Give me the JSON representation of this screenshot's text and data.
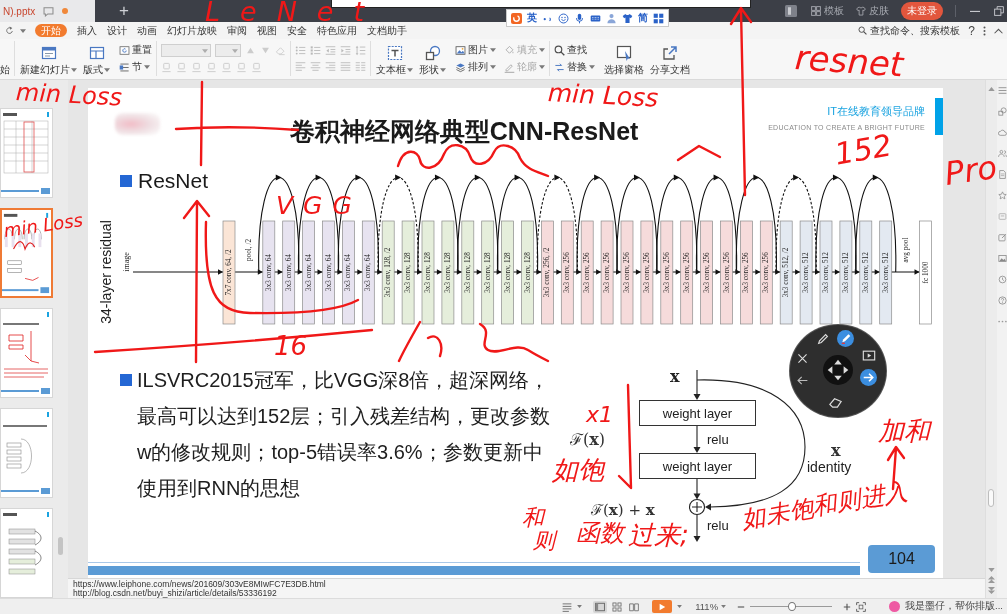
{
  "title_bar": {
    "document_tab": "N).pptx",
    "new_tab": "+",
    "template": "模板",
    "skin": "皮肤",
    "login": "未登录"
  },
  "menu": {
    "tabs": [
      {
        "label": "开始",
        "selected": true
      },
      {
        "label": "插入",
        "selected": false
      },
      {
        "label": "设计",
        "selected": false
      },
      {
        "label": "动画",
        "selected": false
      },
      {
        "label": "幻灯片放映",
        "selected": false
      },
      {
        "label": "审阅",
        "selected": false
      },
      {
        "label": "视图",
        "selected": false
      },
      {
        "label": "安全",
        "selected": false
      },
      {
        "label": "特色应用",
        "selected": false
      },
      {
        "label": "文档助手",
        "selected": false
      }
    ],
    "search": "查找命令、搜索模板",
    "help": "?"
  },
  "ime_toolbar": {
    "mode": "英",
    "script": "简"
  },
  "ribbon": [
    {
      "kind": "stack",
      "items": [
        {
          "label": "始",
          "disabled": false,
          "dropdown": false
        }
      ]
    },
    {
      "kind": "large",
      "items": [
        {
          "label": "新建幻灯片",
          "disabled": false,
          "dropdown": true
        },
        {
          "label": "版式",
          "disabled": false,
          "dropdown": true
        }
      ]
    },
    {
      "kind": "stack",
      "items": [
        {
          "label": "重置",
          "disabled": false,
          "dropdown": false
        },
        {
          "label": "节",
          "disabled": false,
          "dropdown": true
        }
      ]
    },
    {
      "kind": "font",
      "disabled": true
    },
    {
      "kind": "paragraph",
      "disabled": true
    },
    {
      "kind": "large",
      "items": [
        {
          "label": "文本框",
          "disabled": false,
          "dropdown": true
        },
        {
          "label": "形状",
          "disabled": false,
          "dropdown": true
        }
      ]
    },
    {
      "kind": "stack",
      "items": [
        {
          "label": "图片",
          "disabled": false,
          "dropdown": true
        },
        {
          "label": "排列",
          "disabled": false,
          "dropdown": true
        }
      ]
    },
    {
      "kind": "stack",
      "items": [
        {
          "label": "填充",
          "disabled": true,
          "dropdown": true
        },
        {
          "label": "轮廓",
          "disabled": true,
          "dropdown": true
        }
      ]
    },
    {
      "kind": "stack",
      "items": [
        {
          "label": "查找",
          "disabled": false,
          "dropdown": false
        },
        {
          "label": "替换",
          "disabled": false,
          "dropdown": true
        }
      ]
    },
    {
      "kind": "large",
      "items": [
        {
          "label": "选择窗格",
          "disabled": false,
          "dropdown": false
        },
        {
          "label": "分享文档",
          "disabled": false,
          "dropdown": false
        }
      ]
    }
  ],
  "thumbnails": [
    {
      "selected": false
    },
    {
      "selected": true
    },
    {
      "selected": false
    },
    {
      "selected": false
    },
    {
      "selected": false
    }
  ],
  "slide": {
    "title": "卷积神经网络典型CNN-ResNet",
    "brand": {
      "slogan": "IT在线教育领导品牌",
      "tagline": "EDUCATION TO CREATE A BRIGHT FUTURE"
    },
    "heading": "ResNet",
    "diagram": {
      "title": "34-layer residual",
      "input": "image",
      "layers": [
        {
          "label": "7x7 conv, 64, /2",
          "kind": "box",
          "color": "#fbe5d6"
        },
        {
          "label": "pool, /2",
          "kind": "text"
        },
        {
          "label": "3x3 conv, 64",
          "kind": "box",
          "color": "#e7e3f0"
        },
        {
          "label": "3x3 conv, 64",
          "kind": "box",
          "color": "#e7e3f0"
        },
        {
          "label": "3x3 conv, 64",
          "kind": "box",
          "color": "#e7e3f0"
        },
        {
          "label": "3x3 conv, 64",
          "kind": "box",
          "color": "#e7e3f0"
        },
        {
          "label": "3x3 conv, 64",
          "kind": "box",
          "color": "#e7e3f0"
        },
        {
          "label": "3x3 conv, 64",
          "kind": "box",
          "color": "#e7e3f0"
        },
        {
          "label": "3x3 conv, 128, /2",
          "kind": "box",
          "color": "#e5eedb"
        },
        {
          "label": "3x3 conv, 128",
          "kind": "box",
          "color": "#e5eedb"
        },
        {
          "label": "3x3 conv, 128",
          "kind": "box",
          "color": "#e5eedb"
        },
        {
          "label": "3x3 conv, 128",
          "kind": "box",
          "color": "#e5eedb"
        },
        {
          "label": "3x3 conv, 128",
          "kind": "box",
          "color": "#e5eedb"
        },
        {
          "label": "3x3 conv, 128",
          "kind": "box",
          "color": "#e5eedb"
        },
        {
          "label": "3x3 conv, 128",
          "kind": "box",
          "color": "#e5eedb"
        },
        {
          "label": "3x3 conv, 128",
          "kind": "box",
          "color": "#e5eedb"
        },
        {
          "label": "3x3 conv, 256, /2",
          "kind": "box",
          "color": "#f6dbdb"
        },
        {
          "label": "3x3 conv, 256",
          "kind": "box",
          "color": "#f6dbdb"
        },
        {
          "label": "3x3 conv, 256",
          "kind": "box",
          "color": "#f6dbdb"
        },
        {
          "label": "3x3 conv, 256",
          "kind": "box",
          "color": "#f6dbdb"
        },
        {
          "label": "3x3 conv, 256",
          "kind": "box",
          "color": "#f6dbdb"
        },
        {
          "label": "3x3 conv, 256",
          "kind": "box",
          "color": "#f6dbdb"
        },
        {
          "label": "3x3 conv, 256",
          "kind": "box",
          "color": "#f6dbdb"
        },
        {
          "label": "3x3 conv, 256",
          "kind": "box",
          "color": "#f6dbdb"
        },
        {
          "label": "3x3 conv, 256",
          "kind": "box",
          "color": "#f6dbdb"
        },
        {
          "label": "3x3 conv, 256",
          "kind": "box",
          "color": "#f6dbdb"
        },
        {
          "label": "3x3 conv, 256",
          "kind": "box",
          "color": "#f6dbdb"
        },
        {
          "label": "3x3 conv, 256",
          "kind": "box",
          "color": "#f6dbdb"
        },
        {
          "label": "3x3 conv, 512, /2",
          "kind": "box",
          "color": "#e3e9f1"
        },
        {
          "label": "3x3 conv, 512",
          "kind": "box",
          "color": "#e3e9f1"
        },
        {
          "label": "3x3 conv, 512",
          "kind": "box",
          "color": "#e3e9f1"
        },
        {
          "label": "3x3 conv, 512",
          "kind": "box",
          "color": "#e3e9f1"
        },
        {
          "label": "3x3 conv, 512",
          "kind": "box",
          "color": "#e3e9f1"
        },
        {
          "label": "3x3 conv, 512",
          "kind": "box",
          "color": "#e3e9f1"
        },
        {
          "label": "avg pool",
          "kind": "text"
        },
        {
          "label": "fc 1000",
          "kind": "box"
        }
      ],
      "shortcuts": [
        {
          "dashed": false
        },
        {
          "dashed": false
        },
        {
          "dashed": false
        },
        {
          "dashed": true
        },
        {
          "dashed": false
        },
        {
          "dashed": false
        },
        {
          "dashed": false
        },
        {
          "dashed": true
        },
        {
          "dashed": false
        },
        {
          "dashed": false
        },
        {
          "dashed": false
        },
        {
          "dashed": false
        },
        {
          "dashed": false
        },
        {
          "dashed": true
        },
        {
          "dashed": false
        },
        {
          "dashed": false
        }
      ]
    },
    "description": "ILSVRC2015冠军，比VGG深8倍，超深网络，最高可以达到152层；引入残差结构，更改参数w的修改规则；top-5错误率3.6%；参数更新中使用到RNN的思想",
    "residual_block": {
      "input": "x",
      "layers": [
        "weight layer",
        "weight layer"
      ],
      "activations": [
        "relu",
        "relu"
      ],
      "function": "ℱ(**x**)",
      "shortcut": "x",
      "shortcut_label": "identity",
      "output": "ℱ(**x**) + **x**"
    },
    "page_number": "104"
  },
  "notes": [
    "https://www.leiphone.com/news/201609/303vE8MIwFC7E3DB.html",
    "http://blog.csdn.net/buyi_shizi/article/details/53336192"
  ],
  "status_bar": {
    "views": [
      {
        "selected": true
      },
      {
        "selected": false
      },
      {
        "selected": false
      }
    ],
    "zoom": "111%",
    "zoom_slider": {
      "level": 0.51
    },
    "assistant": "我是墨仔，帮你排版..."
  },
  "ink_annotations": [
    {
      "text": "LeNet"
    },
    {
      "text": "min Loss"
    },
    {
      "text": "min Loss"
    },
    {
      "text": "resnet"
    },
    {
      "text": "min Loss"
    },
    {
      "text": "152"
    },
    {
      "text": "Pro"
    },
    {
      "text": "VGG"
    },
    {
      "text": "16"
    },
    {
      "text": "x1"
    },
    {
      "text": "如饱"
    },
    {
      "text": "和"
    },
    {
      "text": "则"
    },
    {
      "text": "函数"
    },
    {
      "text": "过来;"
    },
    {
      "text": "如未饱和则进入"
    },
    {
      "text": "加和"
    }
  ]
}
